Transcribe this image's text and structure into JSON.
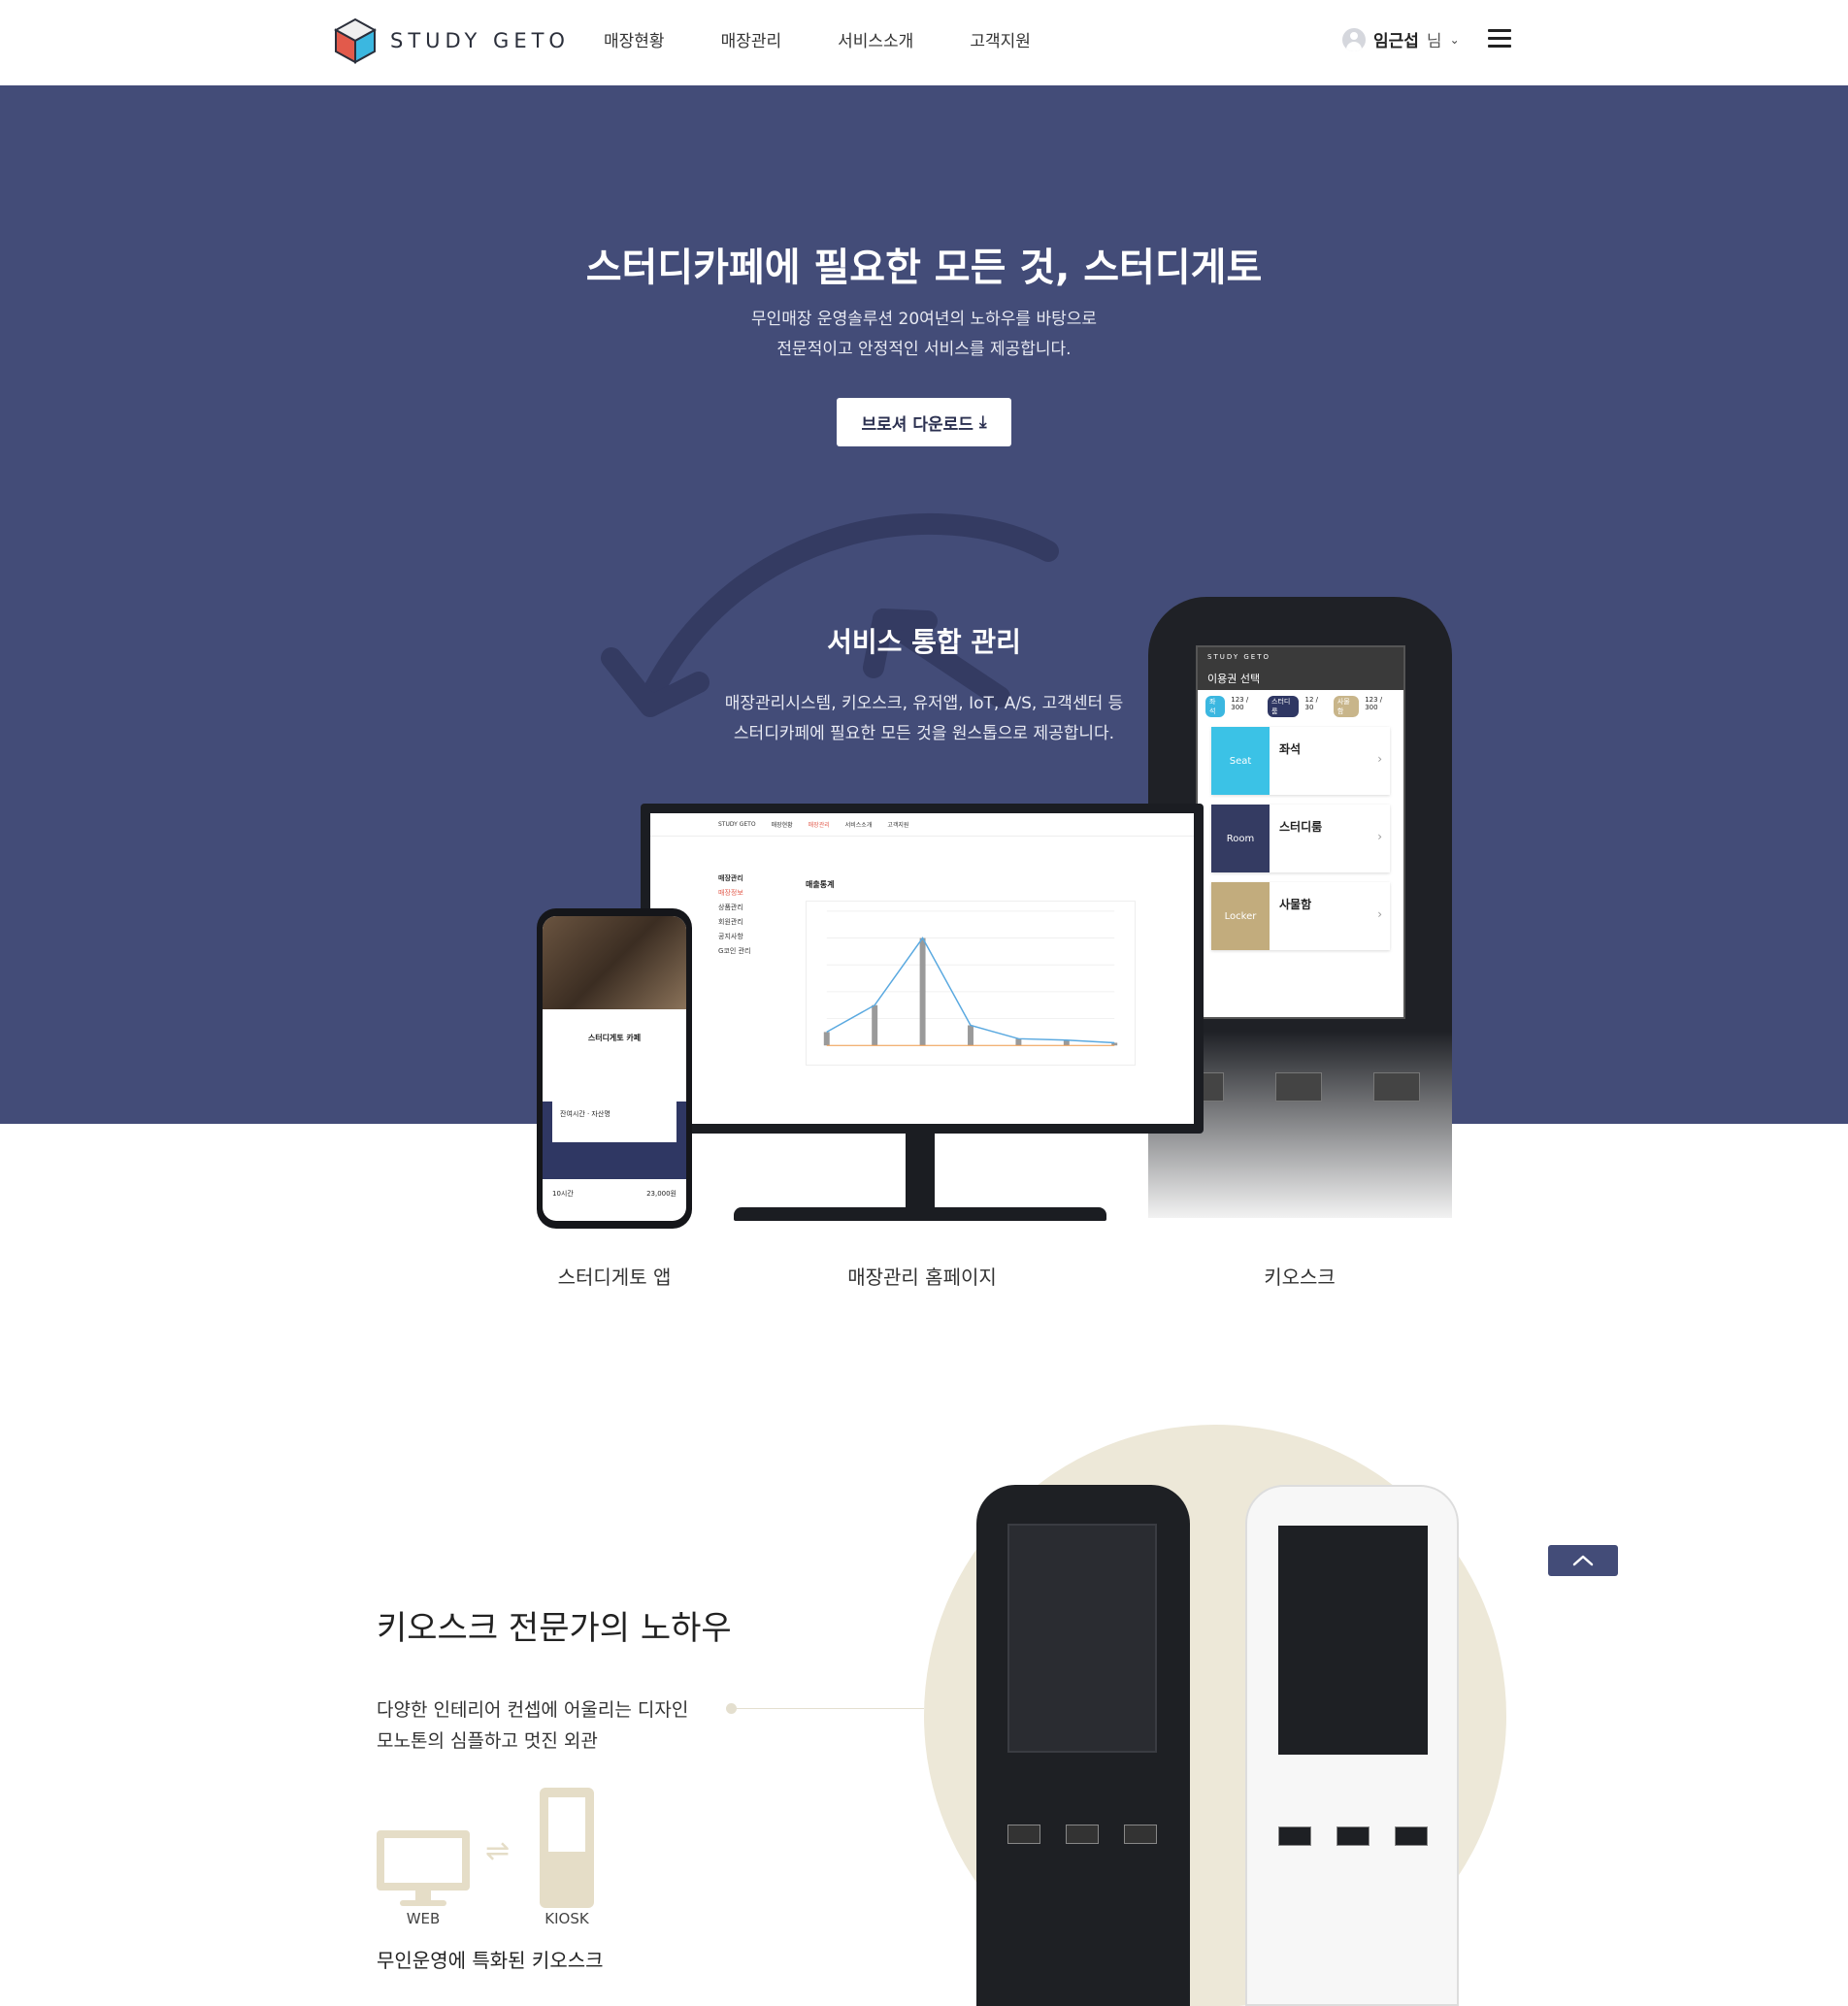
{
  "header": {
    "logo_text": "STUDY GETO",
    "nav": [
      "매장현황",
      "매장관리",
      "서비스소개",
      "고객지원"
    ],
    "user_name": "임근섭",
    "user_suffix": "님"
  },
  "hero": {
    "title": "스터디카페에 필요한 모든 것, 스터디게토",
    "subtitle_lines": [
      "무인매장 운영솔루션 20여년의 노하우를 바탕으로",
      "전문적이고 안정적인 서비스를 제공합니다."
    ],
    "download_label": "브로셔 다운로드",
    "colors": {
      "background": "#434c78",
      "cycle_arrow": "#343b62"
    }
  },
  "service": {
    "title": "서비스 통합 관리",
    "subtitle_lines": [
      "매장관리시스템, 키오스크, 유저앱, IoT, A/S, 고객센터 등",
      "스터디카페에 필요한 모든 것을 원스톱으로 제공합니다."
    ]
  },
  "kiosk_screen": {
    "brand": "STUDY GETO",
    "title": "이용권 선택",
    "tags": [
      {
        "label": "좌석",
        "count": "123 / 300",
        "color": "#3bb7e0"
      },
      {
        "label": "스터디룸",
        "count": "12 / 30",
        "color": "#2f3763"
      },
      {
        "label": "사물함",
        "count": "123 / 300",
        "color": "#c8b58a"
      }
    ],
    "cards": [
      {
        "title": "좌석",
        "icon_label": "Seat",
        "color": "#3bc2e6"
      },
      {
        "title": "스터디룸",
        "icon_label": "Room",
        "color": "#343b62"
      },
      {
        "title": "사물함",
        "icon_label": "Locker",
        "color": "#c2ac7d"
      }
    ]
  },
  "monitor_screen": {
    "brand": "STUDY GETO",
    "nav": [
      "매장현황",
      "매장관리",
      "서비스소개",
      "고객지원"
    ],
    "sidebar_title": "매장관리",
    "sidebar_items": [
      "매장정보",
      "상품관리",
      "회원관리",
      "공지사항",
      "G코인 관리"
    ],
    "chart_title": "매출통계"
  },
  "phone_screen": {
    "store_name": "스터디게토 카페",
    "time_label": "잔여시간 · 자산명",
    "price": "23,000원",
    "hours": "10시간"
  },
  "devices": {
    "labels": [
      "스터디게토 앱",
      "매장관리 홈페이지",
      "키오스크"
    ]
  },
  "section2": {
    "title": "키오스크 전문가의 노하우",
    "subtitle_lines": [
      "다양한 인테리어 컨셉에 어울리는 디자인",
      "모노톤의 심플하고 멋진 외관"
    ],
    "web_label": "WEB",
    "kiosk_label": "KIOSK",
    "bottom_text": "무인운영에 특화된 키오스크",
    "colors": {
      "circle": "#ede8d8",
      "icon": "#e5ddc7"
    }
  },
  "chart_data": {
    "type": "line",
    "title": "",
    "xlabel": "",
    "ylabel": "",
    "x": [
      1,
      2,
      3,
      4,
      5,
      6,
      7
    ],
    "series": [
      {
        "values": [
          10,
          30,
          80,
          15,
          5,
          4,
          2
        ]
      }
    ]
  }
}
